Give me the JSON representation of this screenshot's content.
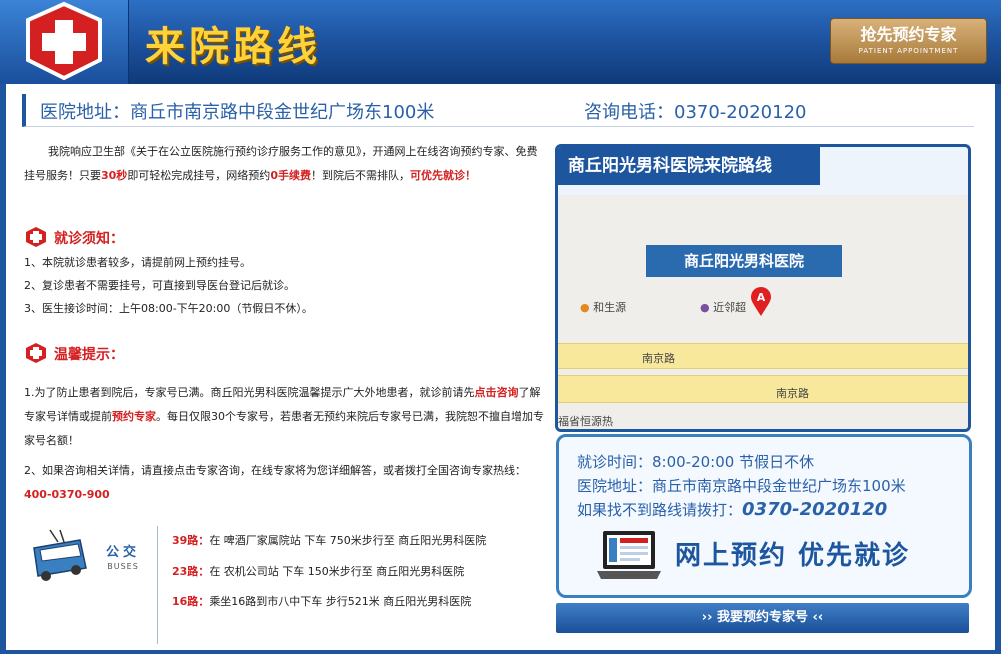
{
  "header": {
    "title": "来院路线",
    "appointment_button": {
      "label": "抢先预约专家",
      "sub_label": "PATIENT APPOINTMENT"
    }
  },
  "address_bar": {
    "address": "医院地址：商丘市南京路中段金世纪广场东100米",
    "phone": "咨询电话：0370-2020120"
  },
  "intro": {
    "part1": "我院响应卫生部《关于在公立医院施行预约诊疗服务工作的意见》，开通网上在线咨询预约专家、免费挂号服务！只要",
    "highlight1": "30秒",
    "part2": "即可轻松完成挂号，网络预约",
    "highlight2": "0手续费",
    "part3": "！到院后不需排队，",
    "highlight3": "可优先就诊！"
  },
  "notice": {
    "heading": "就诊须知：",
    "items": [
      "1、本院就诊患者较多，请提前网上预约挂号。",
      "2、复诊患者不需要挂号，可直接到导医台登记后就诊。",
      "3、医生接诊时间：上午08:00-下午20:00（节假日不休）。"
    ]
  },
  "tips": {
    "heading": "温馨提示：",
    "p1_a": "1.为了防止患者到院后，专家号已满。商丘阳光男科医院温馨提示广大外地患者，就诊前请先",
    "p1_link1": "点击咨询",
    "p1_b": "了解专家号详情或提前",
    "p1_link2": "预约专家",
    "p1_c": "。每日仅限30个专家号，若患者无预约来院后专家号已满，我院恕不擅自增加专家号名额！",
    "p2_a": "2、如果咨询相关详情，请直接点击专家咨询，在线专家将为您详细解答，或者拨打全国咨询专家热线：",
    "p2_hotline": "400-0370-900"
  },
  "bus": {
    "title": "公交",
    "subtitle": "BUSES",
    "routes": [
      {
        "num": "39路：",
        "text": "在 啤酒厂家属院站 下车 750米步行至 商丘阳光男科医院"
      },
      {
        "num": "23路：",
        "text": "在 农机公司站 下车 150米步行至 商丘阳光男科医院"
      },
      {
        "num": "16路：",
        "text": "乘坐16路到市八中下车 步行521米 商丘阳光男科医院"
      }
    ]
  },
  "map": {
    "title": "商丘阳光男科医院来院路线",
    "hospital_label": "商丘阳光男科医院",
    "poi1": "和生源",
    "poi2": "近邻超",
    "pin_letter": "A",
    "road1": "南京路",
    "road2": "南京路",
    "poi3": "福省恒源热"
  },
  "info": {
    "hours": "就诊时间：8:00-20:00 节假日不休",
    "address": "医院地址：商丘市南京路中段金世纪广场东100米",
    "call_prefix": "如果找不到路线请拨打：",
    "call_number": "0370-2020120",
    "online_booking": "网上预约 优先就诊"
  },
  "expert_button": {
    "label": "›› 我要预约专家号 ‹‹"
  },
  "colors": {
    "brand_blue": "#1d569f",
    "accent_red": "#d42020",
    "title_gold": "#ffd23a",
    "road_yellow": "#f7e89c"
  }
}
